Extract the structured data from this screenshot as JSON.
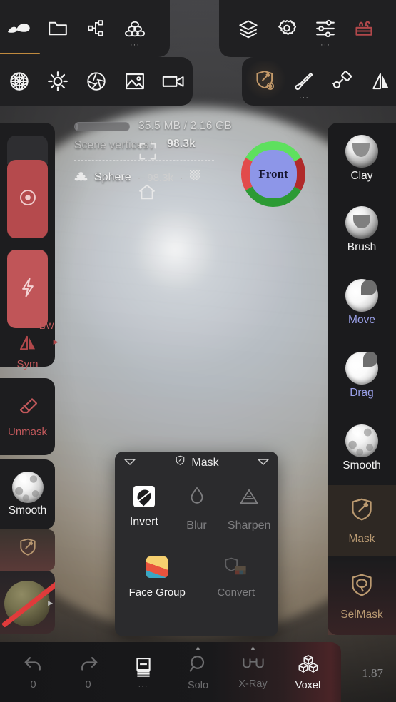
{
  "app": {
    "version": "1.87"
  },
  "top_toolbar_left": {
    "items": [
      {
        "name": "nomad-logo",
        "icon": "nomad-logo-icon",
        "active": true
      },
      {
        "name": "files",
        "icon": "folder-icon",
        "active": false
      },
      {
        "name": "topology",
        "icon": "share-nodes-icon",
        "active": false
      },
      {
        "name": "primitives",
        "icon": "stack-blocks-icon",
        "active": false,
        "more": "···"
      }
    ]
  },
  "top_toolbar_right": {
    "items": [
      {
        "name": "layers",
        "icon": "layers-icon"
      },
      {
        "name": "settings",
        "icon": "gear-icon"
      },
      {
        "name": "sliders",
        "icon": "sliders-icon",
        "more": "···"
      },
      {
        "name": "toolbox",
        "icon": "toolbox-icon"
      }
    ]
  },
  "second_toolbar_left": {
    "items": [
      {
        "name": "material",
        "icon": "grid-sphere-icon"
      },
      {
        "name": "lighting",
        "icon": "sun-icon"
      },
      {
        "name": "post-process",
        "icon": "aperture-icon"
      },
      {
        "name": "scene-image",
        "icon": "image-icon"
      },
      {
        "name": "camera",
        "icon": "video-camera-icon"
      }
    ]
  },
  "second_toolbar_right": {
    "items": [
      {
        "name": "mask-settings",
        "icon": "shield-gear-icon",
        "active": true
      },
      {
        "name": "brush",
        "icon": "paint-brush-icon",
        "more": "···"
      },
      {
        "name": "paint-roller",
        "icon": "paint-roller-icon"
      },
      {
        "name": "mirror",
        "icon": "mirror-icon"
      }
    ]
  },
  "hud": {
    "memory": "35.5 MB / 2.16 GB",
    "scene_vertices_label": "Scene vertices：",
    "scene_vertices_value": "98.3k",
    "object_name": "Sphere",
    "object_separator": "·",
    "object_vertices": "98.3k",
    "object_icon": "stack-blocks-icon",
    "checker_icon": "checker-icon",
    "frame_icon": "frame-selection-icon",
    "home_icon": "home-icon"
  },
  "view_gizmo": {
    "label": "Front",
    "center_color": "#8d96e8",
    "top_color": "#5ee05e",
    "bottom_color": "#2c9a34",
    "left_color": "#e24b4b",
    "right_color": "#b02a2a"
  },
  "left_sidebar": {
    "record_button": {
      "label": "",
      "icon": "record-dot-icon",
      "color": "#b54a4d"
    },
    "lightning_button": {
      "label": "",
      "icon": "lightning-bolt-icon",
      "color": "#c05558"
    },
    "symmetry": {
      "label": "Sym",
      "badge": "L/W",
      "icon": "mirror-triangle-icon",
      "color": "#c1585b"
    },
    "unmask": {
      "label": "Unmask",
      "icon": "eraser-icon"
    },
    "smooth": {
      "label": "Smooth",
      "icon": "smooth-sphere-icon"
    },
    "mask": {
      "label": "",
      "icon": "shield-brush-icon"
    },
    "material_ball": {
      "label": "",
      "icon": "material-sphere-disabled-icon"
    }
  },
  "right_sidebar": {
    "items": [
      {
        "label": "Clay",
        "icon": "clay-brush-icon",
        "state": "normal"
      },
      {
        "label": "Brush",
        "icon": "brush-icon",
        "state": "normal"
      },
      {
        "label": "Move",
        "icon": "move-brush-icon",
        "state": "accent"
      },
      {
        "label": "Drag",
        "icon": "drag-brush-icon",
        "state": "accent"
      },
      {
        "label": "Smooth",
        "icon": "smooth-brush-icon",
        "state": "normal"
      },
      {
        "label": "Mask",
        "icon": "shield-brush-icon",
        "state": "selected"
      },
      {
        "label": "SelMask",
        "icon": "shield-lasso-icon",
        "state": "tan"
      }
    ]
  },
  "mask_popup": {
    "title": "Mask",
    "title_icon": "shield-brush-icon",
    "collapse_left_icon": "caret-down-icon",
    "collapse_right_icon": "caret-down-icon",
    "row1": [
      {
        "label": "Invert",
        "icon": "invert-icon",
        "enabled": true
      },
      {
        "label": "Blur",
        "icon": "droplet-icon",
        "enabled": false
      },
      {
        "label": "Sharpen",
        "icon": "sharpen-icon",
        "enabled": false
      }
    ],
    "row2": [
      {
        "label": "Face Group",
        "icon": "face-group-icon",
        "enabled": true
      },
      {
        "label": "Convert",
        "icon": "convert-icon",
        "enabled": false
      }
    ]
  },
  "bottom_bar": {
    "items": [
      {
        "label": "0",
        "icon": "undo-icon",
        "enabled": false
      },
      {
        "label": "0",
        "icon": "redo-icon",
        "enabled": false
      },
      {
        "label": "",
        "icon": "book-icon",
        "enabled": true,
        "more": "···"
      },
      {
        "label": "Solo",
        "icon": "search-icon",
        "enabled": false
      },
      {
        "label": "X-Ray",
        "icon": "glasses-icon",
        "enabled": false
      },
      {
        "label": "Voxel",
        "icon": "voxel-icon",
        "enabled": true
      }
    ]
  }
}
